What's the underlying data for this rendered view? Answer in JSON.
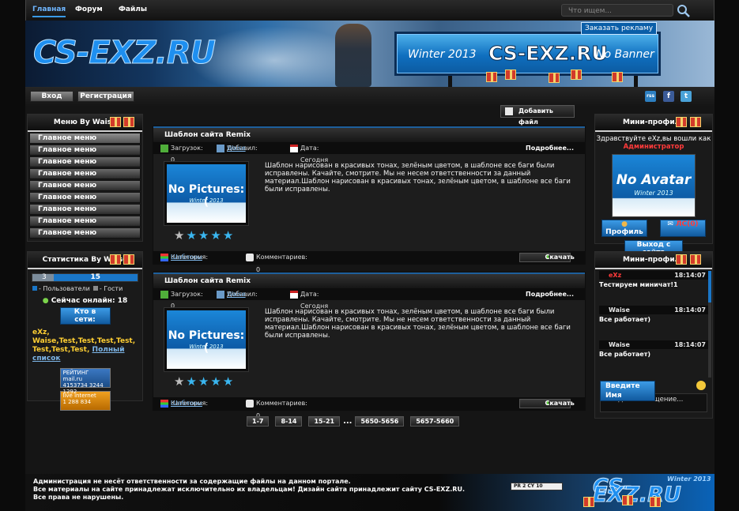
{
  "nav": {
    "home": "Главная",
    "forum": "Форум",
    "files": "Файлы"
  },
  "search": {
    "placeholder": "Что ищем..."
  },
  "banner": {
    "logo": "CS-EXZ.RU",
    "order_ad": "Заказать рекламу",
    "ad_left": "Winter 2013",
    "ad_logo": "CS-EXZ.RU",
    "ad_right": "No Banner"
  },
  "auth": {
    "login": "Вход",
    "register": "Регистрация"
  },
  "social": {
    "rss": "rss",
    "facebook": "f",
    "twitter": "t"
  },
  "add_file": "Добавить файл",
  "left_menu": {
    "title": "Меню By Waise",
    "items": [
      "Главное меню",
      "Главное меню",
      "Главное меню",
      "Главное меню",
      "Главное меню",
      "Главное меню",
      "Главное меню",
      "Главное меню",
      "Главное меню"
    ]
  },
  "stats": {
    "title": "Статистика By Waise",
    "users_count": "3",
    "guests_count": "15",
    "legend_users": "- Пользователи",
    "legend_guests": "- Гости",
    "online_now": "Сейчас онлайн: 18",
    "who_online_btn": "Кто в сети:",
    "online_users": "eXz, Waise,Test,Test,Test,Test, Test,Test,Test,",
    "full_list": "Полный список",
    "counter1": {
      "label": "РЕЙТИНГ mail.ru",
      "values": "4153734 3244 1292"
    },
    "counter2": {
      "label": "live internet",
      "values": "1 288 834"
    }
  },
  "posts": [
    {
      "title": "Шаблон сайта Remix",
      "downloads": "Загрузок: 0",
      "added_by_label": "Добавил:",
      "added_by": "Waise",
      "date": "Дата: Сегодня",
      "more": "Подробнее...",
      "image_title": "No Pictures:(",
      "image_sub": "Winter 2013",
      "rating": 4,
      "text": "Шаблон нарисован в красивых тонах, зелёным цветом, в шаблоне все баги были исправлены. Качайте, смотрите. Мы не несем ответственности за  данный материал.Шаблон нарисован в красивых тонах, зелёным цветом, в шаблоне все баги были исправлены.",
      "category_label": "Категория:",
      "category": "Шаблоны",
      "comments": "Комментариев: 0",
      "download": "Скачать"
    },
    {
      "title": "Шаблон сайта Remix",
      "downloads": "Загрузок: 0",
      "added_by_label": "Добавил:",
      "added_by": "Waise",
      "date": "Дата: Сегодня",
      "more": "Подробнее...",
      "image_title": "No Pictures:(",
      "image_sub": "Winter 2013",
      "rating": 4,
      "text": "Шаблон нарисован в красивых тонах, зелёным цветом, в шаблоне все баги были исправлены. Качайте, смотрите. Мы не несем ответственности за  данный материал.Шаблон нарисован в красивых тонах, зелёным цветом, в шаблоне все баги были исправлены.",
      "category_label": "Категория:",
      "category": "Шаблоны",
      "comments": "Комментариев: 0",
      "download": "Скачать"
    }
  ],
  "pager": [
    "1-7",
    "8-14",
    "15-21",
    "...",
    "5650-5656",
    "5657-5660"
  ],
  "mini_profile": {
    "title": "Мини-профиль",
    "welcome": "Здравствуйте eXz,вы вошли как",
    "role": "Администратор",
    "avatar_title": "No Avatar",
    "avatar_sub": "Winter 2013",
    "profile_btn": "Профиль",
    "messages_btn": "ЛС(0)",
    "logout_btn": "Выход с сайта"
  },
  "chat": {
    "title": "Мини-профиль",
    "messages": [
      {
        "name": "eXz",
        "time": "18:14:07",
        "text": "Тестируем миничат!1",
        "color": "#ff3a3a"
      },
      {
        "name": "Waise",
        "time": "18:14:07",
        "text": "Все работает)",
        "color": "#ffffff"
      },
      {
        "name": "Waise",
        "time": "18:14:07",
        "text": "Все работает)",
        "color": "#ffffff"
      }
    ],
    "name_placeholder": "Введите Имя",
    "message_placeholder": "Введите сообщение..."
  },
  "footer": {
    "line1": "Администрация не несёт ответственности за содержащие файлы на данном портале.",
    "line2": "Все материалы на сайте принадлежат исключительно их владельцам! Дизайн сайта принадлежит сайту CS-EXZ.RU.",
    "line3": "Все права не нарушены.",
    "logo": "CS-EXZ.RU",
    "winter": "Winter 2013",
    "scoreboard": "PR 2   CY 10"
  },
  "colors": {
    "accent": "#1a76c7",
    "admin": "#ff3a3a",
    "link": "#7eb7ea"
  }
}
